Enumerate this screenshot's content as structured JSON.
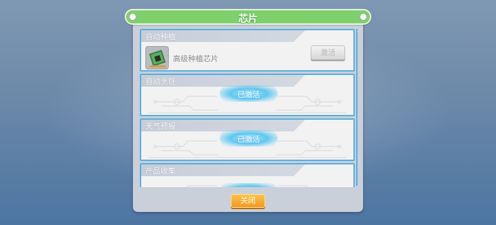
{
  "dialog": {
    "title": "芯片",
    "close_label": "关闭"
  },
  "chips": [
    {
      "category": "自动种植",
      "item_name": "高级种植芯片",
      "button_label": "激活",
      "state": "available"
    },
    {
      "category": "自动烹饪",
      "status_label": "已激活",
      "state": "active"
    },
    {
      "category": "天气预报",
      "status_label": "已激活",
      "state": "active"
    },
    {
      "category": "产品收集",
      "status_label": "",
      "state": "active"
    }
  ]
}
